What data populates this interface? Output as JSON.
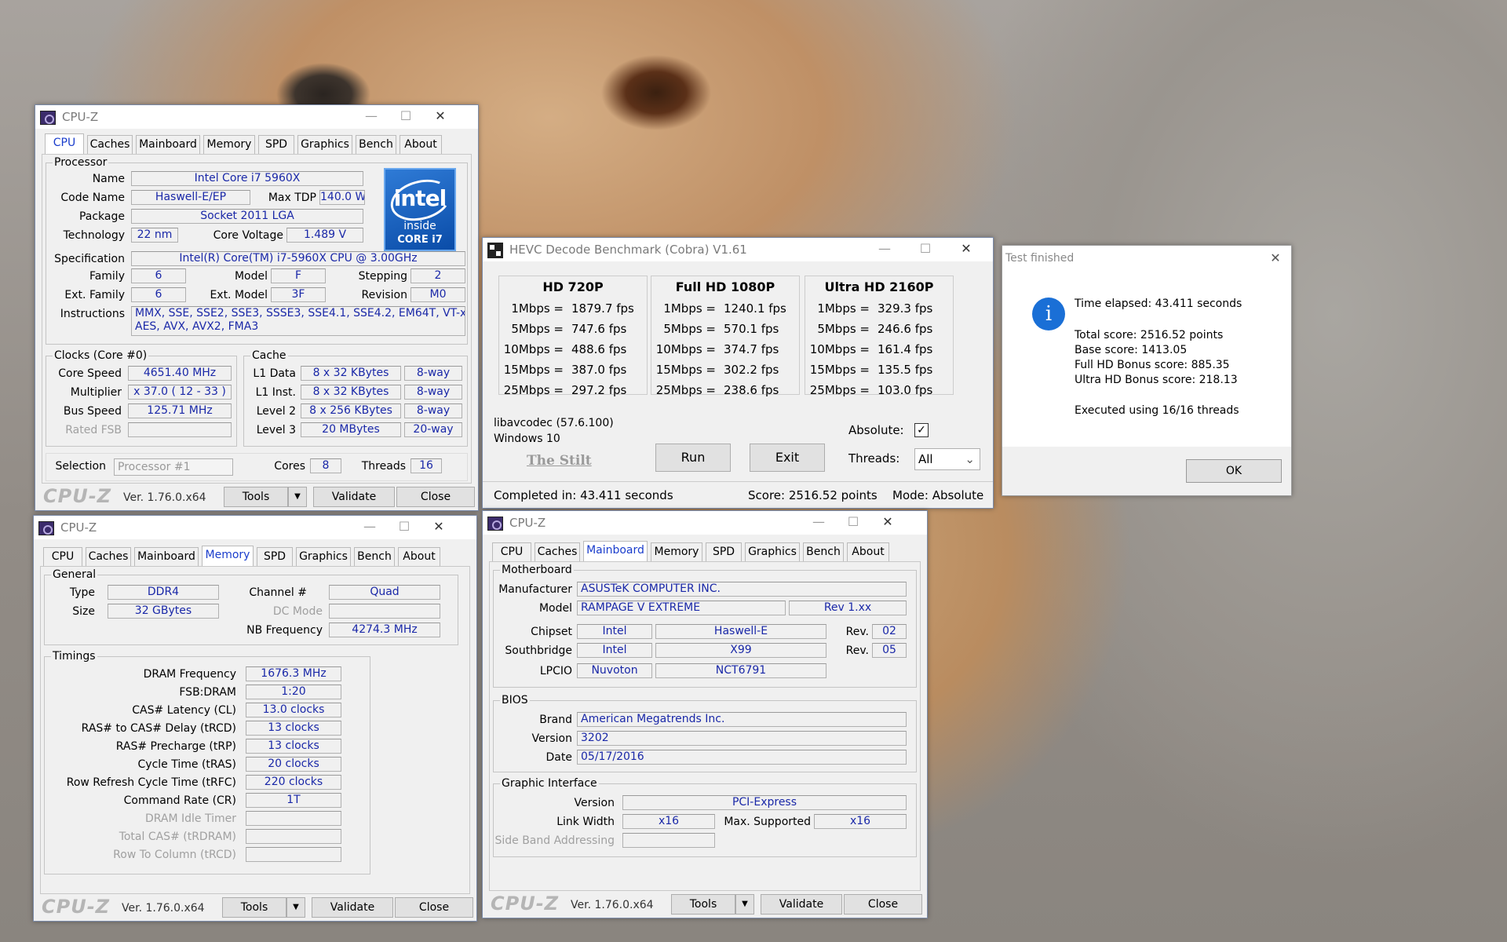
{
  "cpu_window": {
    "title": "CPU-Z",
    "tabs": [
      "CPU",
      "Caches",
      "Mainboard",
      "Memory",
      "SPD",
      "Graphics",
      "Bench",
      "About"
    ],
    "processor_group": "Processor",
    "name_label": "Name",
    "name": "Intel Core i7 5960X",
    "codename_label": "Code Name",
    "codename": "Haswell-E/EP",
    "maxtdp_label": "Max TDP",
    "maxtdp": "140.0 W",
    "package_label": "Package",
    "package": "Socket 2011 LGA",
    "technology_label": "Technology",
    "technology": "22 nm",
    "corevoltage_label": "Core Voltage",
    "corevoltage": "1.489 V",
    "spec_label": "Specification",
    "spec": "Intel(R) Core(TM) i7-5960X CPU @ 3.00GHz",
    "family_label": "Family",
    "family": "6",
    "model_label": "Model",
    "model": "F",
    "stepping_label": "Stepping",
    "stepping": "2",
    "extfamily_label": "Ext. Family",
    "extfamily": "6",
    "extmodel_label": "Ext. Model",
    "extmodel": "3F",
    "revision_label": "Revision",
    "revision": "M0",
    "instructions_label": "Instructions",
    "instructions1": "MMX, SSE, SSE2, SSE3, SSSE3, SSE4.1, SSE4.2, EM64T, VT-x,",
    "instructions2": "AES, AVX, AVX2, FMA3",
    "logo_brand": "intel",
    "logo_inside": "inside",
    "logo_core": "CORE i7",
    "clocks_group": "Clocks (Core #0)",
    "corespeed_label": "Core Speed",
    "corespeed": "4651.40 MHz",
    "multiplier_label": "Multiplier",
    "multiplier": "x 37.0 ( 12 - 33 )",
    "busspeed_label": "Bus Speed",
    "busspeed": "125.71 MHz",
    "ratedfsb_label": "Rated FSB",
    "cache_group": "Cache",
    "l1d_label": "L1 Data",
    "l1d": "8 x 32 KBytes",
    "l1d_way": "8-way",
    "l1i_label": "L1 Inst.",
    "l1i": "8 x 32 KBytes",
    "l1i_way": "8-way",
    "l2_label": "Level 2",
    "l2": "8 x 256 KBytes",
    "l2_way": "8-way",
    "l3_label": "Level 3",
    "l3": "20 MBytes",
    "l3_way": "20-way",
    "selection_label": "Selection",
    "selection": "Processor #1",
    "cores_label": "Cores",
    "cores": "8",
    "threads_label": "Threads",
    "threads": "16",
    "logo": "CPU-Z",
    "version": "Ver. 1.76.0.x64",
    "tools": "Tools",
    "validate": "Validate",
    "close": "Close"
  },
  "mem_window": {
    "title": "CPU-Z",
    "general_group": "General",
    "type_label": "Type",
    "type": "DDR4",
    "channel_label": "Channel #",
    "channel": "Quad",
    "size_label": "Size",
    "size": "32 GBytes",
    "dcmode_label": "DC Mode",
    "nbfreq_label": "NB Frequency",
    "nbfreq": "4274.3 MHz",
    "timings_group": "Timings",
    "timings": [
      {
        "label": "DRAM Frequency",
        "value": "1676.3 MHz",
        "dis": false
      },
      {
        "label": "FSB:DRAM",
        "value": "1:20",
        "dis": false
      },
      {
        "label": "CAS# Latency (CL)",
        "value": "13.0 clocks",
        "dis": false
      },
      {
        "label": "RAS# to CAS# Delay (tRCD)",
        "value": "13 clocks",
        "dis": false
      },
      {
        "label": "RAS# Precharge (tRP)",
        "value": "13 clocks",
        "dis": false
      },
      {
        "label": "Cycle Time (tRAS)",
        "value": "20 clocks",
        "dis": false
      },
      {
        "label": "Row Refresh Cycle Time (tRFC)",
        "value": "220 clocks",
        "dis": false
      },
      {
        "label": "Command Rate (CR)",
        "value": "1T",
        "dis": false
      },
      {
        "label": "DRAM Idle Timer",
        "value": "",
        "dis": true
      },
      {
        "label": "Total CAS# (tRDRAM)",
        "value": "",
        "dis": true
      },
      {
        "label": "Row To Column (tRCD)",
        "value": "",
        "dis": true
      }
    ]
  },
  "mb_window": {
    "title": "CPU-Z",
    "motherboard_group": "Motherboard",
    "manufacturer_label": "Manufacturer",
    "manufacturer": "ASUSTeK COMPUTER INC.",
    "model_label": "Model",
    "model": "RAMPAGE V EXTREME",
    "model_rev": "Rev 1.xx",
    "chipset_label": "Chipset",
    "chipset_vendor": "Intel",
    "chipset": "Haswell-E",
    "rev_label": "Rev.",
    "chipset_rev": "02",
    "southbridge_label": "Southbridge",
    "sb_vendor": "Intel",
    "sb": "X99",
    "sb_rev": "05",
    "lpcio_label": "LPCIO",
    "lpcio_vendor": "Nuvoton",
    "lpcio": "NCT6791",
    "bios_group": "BIOS",
    "brand_label": "Brand",
    "brand": "American Megatrends Inc.",
    "version_label": "Version",
    "version": "3202",
    "date_label": "Date",
    "date": "05/17/2016",
    "gi_group": "Graphic Interface",
    "gi_version_label": "Version",
    "gi_version": "PCI-Express",
    "linkwidth_label": "Link Width",
    "linkwidth": "x16",
    "maxsup_label": "Max. Supported",
    "maxsup": "x16",
    "sideband_label": "Side Band Addressing"
  },
  "hevc_window": {
    "title": "HEVC Decode Benchmark (Cobra) V1.61",
    "columns": [
      {
        "header": "HD 720P",
        "rows": [
          [
            "1Mbps =",
            "1879.7 fps"
          ],
          [
            "5Mbps =",
            "747.6 fps"
          ],
          [
            "10Mbps =",
            "488.6 fps"
          ],
          [
            "15Mbps =",
            "387.0 fps"
          ],
          [
            "25Mbps =",
            "297.2 fps"
          ]
        ]
      },
      {
        "header": "Full HD 1080P",
        "rows": [
          [
            "1Mbps =",
            "1240.1 fps"
          ],
          [
            "5Mbps =",
            "570.1 fps"
          ],
          [
            "10Mbps =",
            "374.7 fps"
          ],
          [
            "15Mbps =",
            "302.2 fps"
          ],
          [
            "25Mbps =",
            "238.6 fps"
          ]
        ]
      },
      {
        "header": "Ultra HD 2160P",
        "rows": [
          [
            "1Mbps =",
            "329.3 fps"
          ],
          [
            "5Mbps =",
            "246.6 fps"
          ],
          [
            "10Mbps =",
            "161.4 fps"
          ],
          [
            "15Mbps =",
            "135.5 fps"
          ],
          [
            "25Mbps =",
            "103.0 fps"
          ]
        ]
      }
    ],
    "libav": "libavcodec (57.6.100)",
    "os": "Windows 10",
    "stilt": "The Stilt",
    "run": "Run",
    "exit": "Exit",
    "absolute_label": "Absolute:",
    "threads_label": "Threads:",
    "threads": "All",
    "completed": "Completed in: 43.411 seconds",
    "score": "Score: 2516.52 points",
    "mode": "Mode: Absolute"
  },
  "dialog": {
    "title": "Test finished",
    "elapsed": "Time elapsed:  43.411 seconds",
    "total": "Total score:  2516.52 points",
    "base": "Base score: 1413.05",
    "fullhd": "Full HD Bonus score: 885.35",
    "ultrahd": "Ultra HD Bonus score: 218.13",
    "executed": "Executed using 16/16 threads",
    "ok": "OK"
  }
}
